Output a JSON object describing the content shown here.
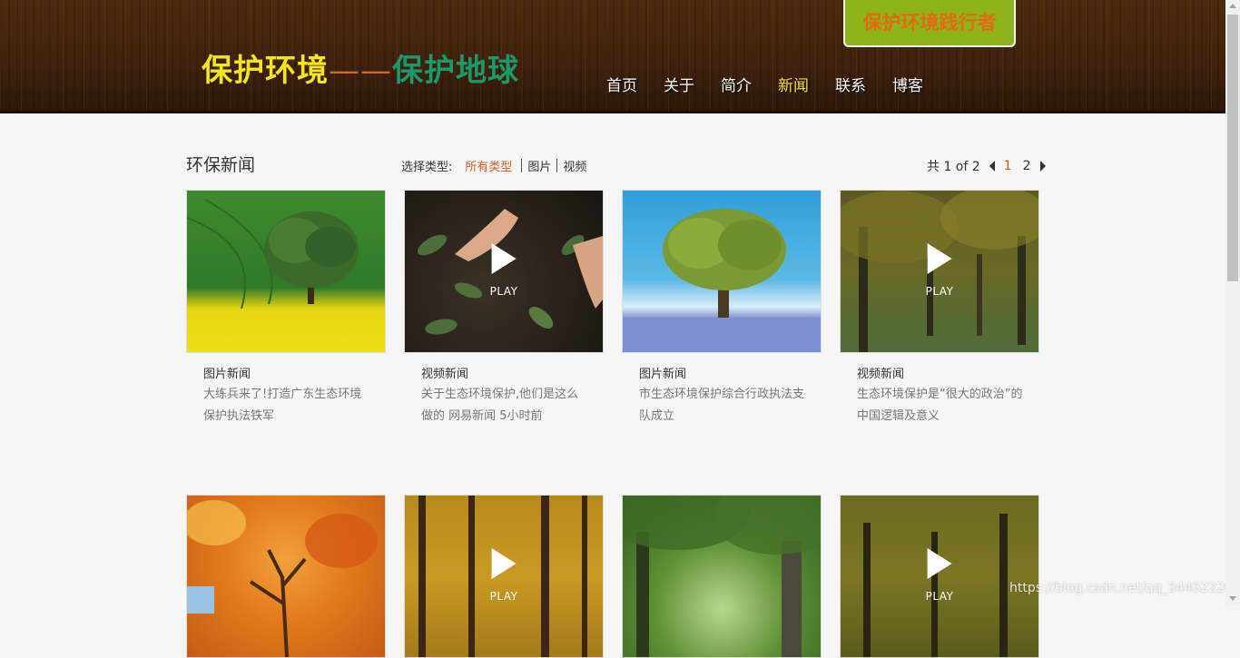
{
  "header": {
    "logo_part1": "保护环境",
    "logo_dash": "——",
    "logo_part2": "保护地球",
    "badge": "保护环境践行者",
    "nav": [
      {
        "label": "首页"
      },
      {
        "label": "关于"
      },
      {
        "label": "简介"
      },
      {
        "label": "新闻",
        "active": true
      },
      {
        "label": "联系"
      },
      {
        "label": "博客"
      }
    ]
  },
  "main": {
    "section_title": "环保新闻",
    "filter": {
      "label": "选择类型:",
      "options": [
        "所有类型",
        "图片",
        "视频"
      ],
      "active": "所有类型"
    },
    "pager": {
      "prefix": "共 1 of 2",
      "pages": [
        "1",
        "2"
      ],
      "current": "1"
    },
    "cards": [
      {
        "type": "图片新闻",
        "desc": "大练兵来了!打造广东生态环境保护执法铁军",
        "video": false
      },
      {
        "type": "视频新闻",
        "desc": "关于生态环境保护,他们是这么做的 网易新闻 5小时前",
        "video": true
      },
      {
        "type": "图片新闻",
        "desc": "市生态环境保护综合行政执法支队成立",
        "video": false
      },
      {
        "type": "视频新闻",
        "desc": "生态环境保护是“很大的政治”的中国逻辑及意义",
        "video": true
      },
      {
        "type": "",
        "desc": "",
        "video": false
      },
      {
        "type": "",
        "desc": "",
        "video": true
      },
      {
        "type": "",
        "desc": "",
        "video": false
      },
      {
        "type": "",
        "desc": "",
        "video": true
      }
    ],
    "play_label": "PLAY"
  },
  "watermark": "https://blog.csdn.net/qq_34462220"
}
